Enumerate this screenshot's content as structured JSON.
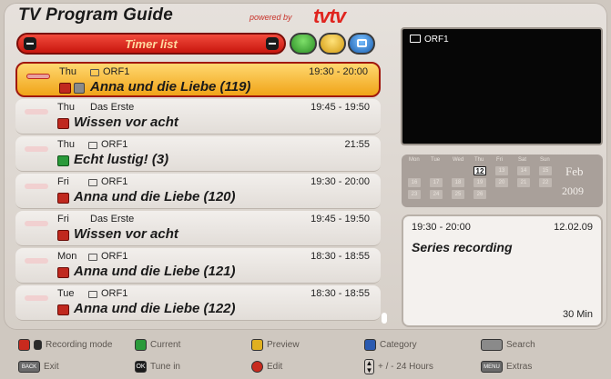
{
  "header": {
    "title": "TV Program Guide",
    "powered_by": "powered by",
    "brand": "tvtv"
  },
  "toolbar": {
    "timer_list_label": "Timer list",
    "colors": {
      "green": "#2a8c24",
      "yellow": "#d29a10",
      "blue": "#1a5fb0",
      "red": "#c8160e"
    }
  },
  "timer_list": [
    {
      "day": "Thu",
      "channel": "ORF1",
      "time": "19:30 - 20:00",
      "title": "Anna und die Liebe (119)",
      "selected": true,
      "channel_icon": "tv-icon",
      "has_info": true,
      "rec_color": "red"
    },
    {
      "day": "Thu",
      "channel": "Das Erste",
      "time": "19:45 - 19:50",
      "title": "Wissen vor acht",
      "selected": false,
      "channel_icon": "",
      "has_info": false,
      "rec_color": "red"
    },
    {
      "day": "Thu",
      "channel": "ORF1",
      "time": "21:55",
      "title": "Echt lustig! (3)",
      "selected": false,
      "channel_icon": "tv-icon",
      "has_info": false,
      "rec_color": "green"
    },
    {
      "day": "Fri",
      "channel": "ORF1",
      "time": "19:30 - 20:00",
      "title": "Anna und die Liebe (120)",
      "selected": false,
      "channel_icon": "tv-icon",
      "has_info": false,
      "rec_color": "red"
    },
    {
      "day": "Fri",
      "channel": "Das Erste",
      "time": "19:45 - 19:50",
      "title": "Wissen vor acht",
      "selected": false,
      "channel_icon": "",
      "has_info": false,
      "rec_color": "red"
    },
    {
      "day": "Mon",
      "channel": "ORF1",
      "time": "18:30 - 18:55",
      "title": "Anna und die Liebe (121)",
      "selected": false,
      "channel_icon": "tv-icon",
      "has_info": false,
      "rec_color": "red"
    },
    {
      "day": "Tue",
      "channel": "ORF1",
      "time": "18:30 - 18:55",
      "title": "Anna und die Liebe (122)",
      "selected": false,
      "channel_icon": "tv-icon",
      "has_info": false,
      "rec_color": "red"
    }
  ],
  "preview": {
    "channel": "ORF1"
  },
  "calendar": {
    "day_headers": [
      "Mon",
      "Tue",
      "Wed",
      "Thu",
      "Fri",
      "Sat",
      "Sun"
    ],
    "rows": [
      [
        "",
        "",
        "",
        "12",
        "13",
        "14",
        "15"
      ],
      [
        "16",
        "17",
        "18",
        "19",
        "20",
        "21",
        "22"
      ],
      [
        "23",
        "24",
        "25",
        "26",
        "",
        "",
        ""
      ]
    ],
    "today": "12",
    "month": "Feb",
    "year": "2009"
  },
  "details": {
    "time": "19:30 - 20:00",
    "date": "12.02.09",
    "title": "Series recording",
    "duration": "30 Min"
  },
  "legend": {
    "recording_mode": "Recording mode",
    "current": "Current",
    "preview": "Preview",
    "category": "Category",
    "search": "Search",
    "exit": "Exit",
    "tune_in": "Tune in",
    "edit": "Edit",
    "hours": "+ / - 24 Hours",
    "extras": "Extras",
    "key_text": "TEXT",
    "key_back": "BACK",
    "key_ok": "OK",
    "key_menu": "MENU"
  }
}
